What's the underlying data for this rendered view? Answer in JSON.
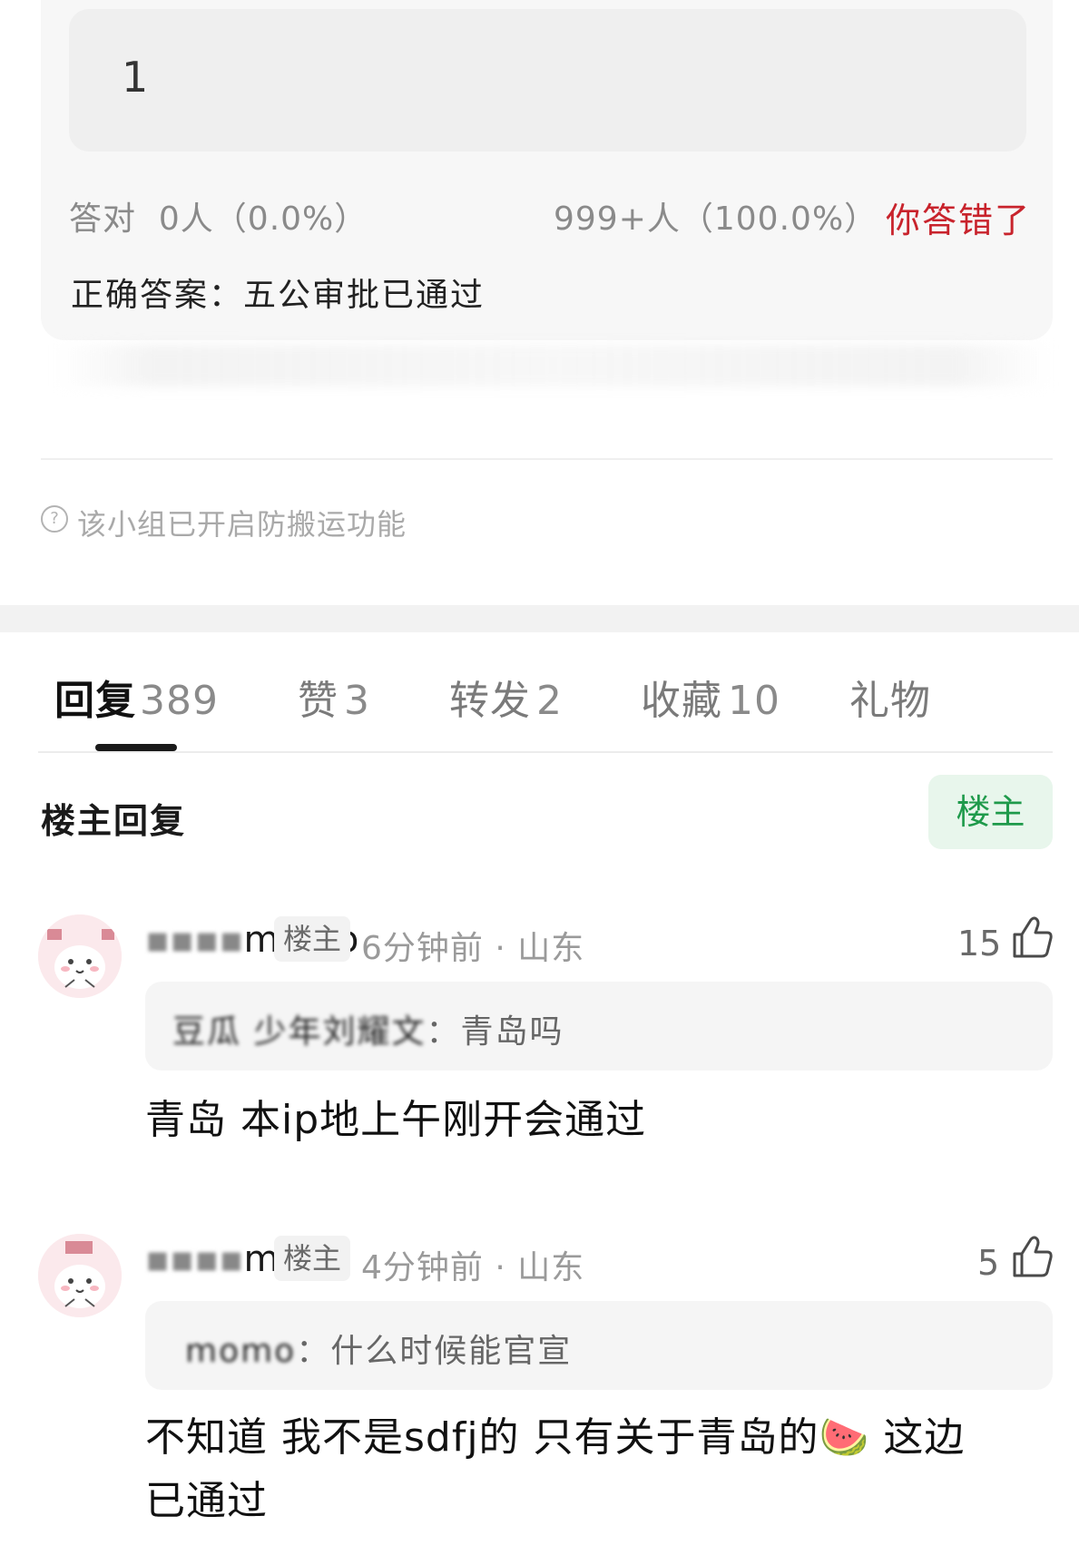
{
  "quiz": {
    "answer_input": "1",
    "correct_stat": "答对  0人（0.0%）",
    "wrong_stat": "999+人（100.0%）",
    "result": "你答错了",
    "correct_answer_label": "正确答案：",
    "correct_answer": "五公审批已通过"
  },
  "notice": {
    "icon": "question-circle-icon",
    "text": "该小组已开启防搬运功能"
  },
  "tabs": [
    {
      "label": "回复",
      "count": "389"
    },
    {
      "label": "赞",
      "count": "3"
    },
    {
      "label": "转发",
      "count": "2"
    },
    {
      "label": "收藏",
      "count": "10"
    },
    {
      "label": "礼物",
      "count": ""
    }
  ],
  "op_section": {
    "title": "楼主回复",
    "filter_button": "楼主"
  },
  "comments": [
    {
      "username": "momo",
      "badge": "楼主",
      "meta": "6分钟前 · 山东",
      "likes": "15",
      "quote_author": "豆瓜 少年刘耀文",
      "quote_text": "：青岛吗",
      "body": "青岛 本ip地上午刚开会通过"
    },
    {
      "username": "mo",
      "badge": "楼主",
      "meta": "4分钟前 · 山东",
      "likes": "5",
      "quote_author": "momo",
      "quote_text": "：什么时候能官宣",
      "body_line1": "不知道 我不是sdfj的 只有关于青岛的",
      "emoji": "🍉",
      "body_line1_end": " 这边",
      "body_line2": "已通过"
    }
  ],
  "colors": {
    "accent_red": "#c8232c",
    "op_green": "#1f9a4b",
    "op_green_bg": "#e8f6ec"
  }
}
